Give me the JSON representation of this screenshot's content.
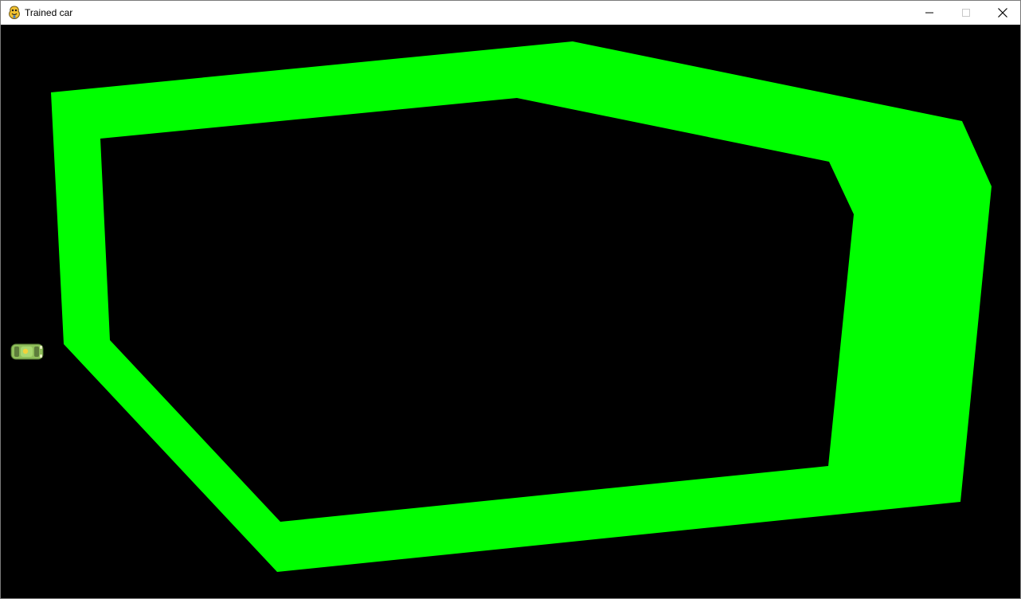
{
  "window": {
    "title": "Trained car",
    "app_icon": "pygame-snake-icon",
    "controls": {
      "minimize_icon": "minimize-icon",
      "maximize_icon": "maximize-icon",
      "close_icon": "close-icon"
    }
  },
  "game": {
    "background_color": "#000000",
    "track_color": "#00ff00",
    "car_color": "#8fbf5a"
  }
}
